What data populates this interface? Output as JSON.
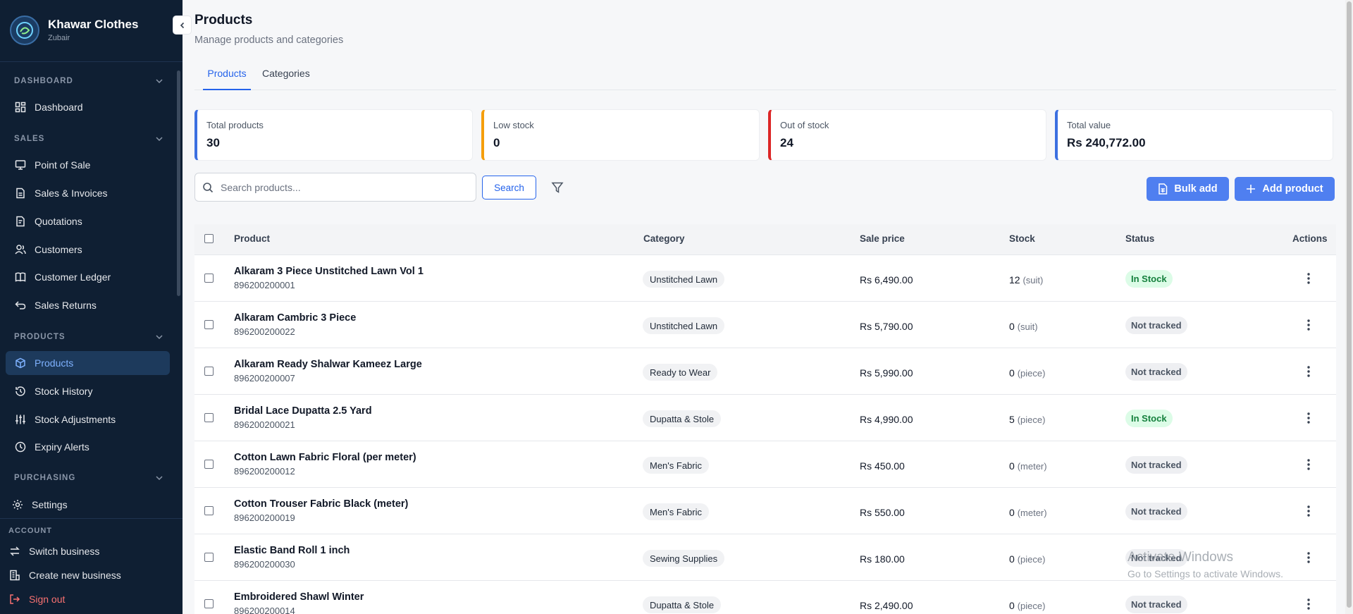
{
  "brand": {
    "name": "Khawar Clothes",
    "user": "Zubair"
  },
  "sidebar": {
    "sections": [
      {
        "label": "DASHBOARD",
        "items": [
          {
            "label": "Dashboard",
            "icon": "grid-icon"
          }
        ]
      },
      {
        "label": "SALES",
        "items": [
          {
            "label": "Point of Sale",
            "icon": "monitor-icon"
          },
          {
            "label": "Sales & Invoices",
            "icon": "file-icon"
          },
          {
            "label": "Quotations",
            "icon": "document-icon"
          },
          {
            "label": "Customers",
            "icon": "users-icon"
          },
          {
            "label": "Customer Ledger",
            "icon": "book-icon"
          },
          {
            "label": "Sales Returns",
            "icon": "return-icon"
          }
        ]
      },
      {
        "label": "PRODUCTS",
        "items": [
          {
            "label": "Products",
            "icon": "box-icon",
            "active": true
          },
          {
            "label": "Stock History",
            "icon": "history-icon"
          },
          {
            "label": "Stock Adjustments",
            "icon": "sliders-icon"
          },
          {
            "label": "Expiry Alerts",
            "icon": "clock-icon"
          }
        ]
      },
      {
        "label": "PURCHASING",
        "items": []
      }
    ],
    "settings": "Settings",
    "account_label": "ACCOUNT",
    "account_items": [
      "Switch business",
      "Create new business",
      "Sign out"
    ]
  },
  "header": {
    "title": "Products",
    "subtitle": "Manage products and categories"
  },
  "tabs": [
    "Products",
    "Categories"
  ],
  "stats": [
    {
      "label": "Total products",
      "value": "30",
      "color": "#3b6fe0"
    },
    {
      "label": "Low stock",
      "value": "0",
      "color": "#f59e0b"
    },
    {
      "label": "Out of stock",
      "value": "24",
      "color": "#dc2626"
    },
    {
      "label": "Total value",
      "value": "Rs 240,772.00",
      "color": "#3b6fe0"
    }
  ],
  "toolbar": {
    "search_placeholder": "Search products...",
    "search_label": "Search",
    "bulk_add_label": "Bulk add",
    "add_product_label": "Add product"
  },
  "table": {
    "columns": [
      "Product",
      "Category",
      "Sale price",
      "Stock",
      "Status",
      "Actions"
    ],
    "rows": [
      {
        "name": "Alkaram 3 Piece Unstitched Lawn Vol 1",
        "sku": "896200200001",
        "category": "Unstitched Lawn",
        "price": "Rs 6,490.00",
        "stock": "12",
        "unit": "(suit)",
        "status": "In Stock"
      },
      {
        "name": "Alkaram Cambric 3 Piece",
        "sku": "896200200022",
        "category": "Unstitched Lawn",
        "price": "Rs 5,790.00",
        "stock": "0",
        "unit": "(suit)",
        "status": "Not tracked"
      },
      {
        "name": "Alkaram Ready Shalwar Kameez Large",
        "sku": "896200200007",
        "category": "Ready to Wear",
        "price": "Rs 5,990.00",
        "stock": "0",
        "unit": "(piece)",
        "status": "Not tracked"
      },
      {
        "name": "Bridal Lace Dupatta 2.5 Yard",
        "sku": "896200200021",
        "category": "Dupatta & Stole",
        "price": "Rs 4,990.00",
        "stock": "5",
        "unit": "(piece)",
        "status": "In Stock"
      },
      {
        "name": "Cotton Lawn Fabric Floral (per meter)",
        "sku": "896200200012",
        "category": "Men's Fabric",
        "price": "Rs 450.00",
        "stock": "0",
        "unit": "(meter)",
        "status": "Not tracked"
      },
      {
        "name": "Cotton Trouser Fabric Black (meter)",
        "sku": "896200200019",
        "category": "Men's Fabric",
        "price": "Rs 550.00",
        "stock": "0",
        "unit": "(meter)",
        "status": "Not tracked"
      },
      {
        "name": "Elastic Band Roll 1 inch",
        "sku": "896200200030",
        "category": "Sewing Supplies",
        "price": "Rs 180.00",
        "stock": "0",
        "unit": "(piece)",
        "status": "Not tracked"
      },
      {
        "name": "Embroidered Shawl Winter",
        "sku": "896200200014",
        "category": "Dupatta & Stole",
        "price": "Rs 2,490.00",
        "stock": "0",
        "unit": "(piece)",
        "status": "Not tracked"
      }
    ]
  },
  "watermark": {
    "line1": "Activate Windows",
    "line2": "Go to Settings to activate Windows."
  }
}
